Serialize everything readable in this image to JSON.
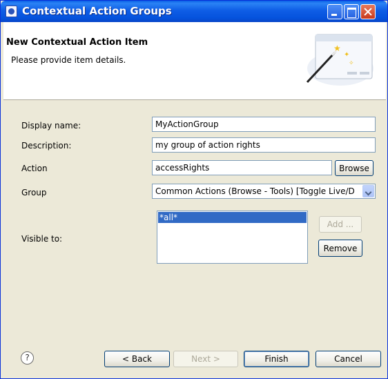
{
  "window": {
    "title": "Contextual Action Groups"
  },
  "header": {
    "title": "New Contextual Action Item",
    "subtitle": "Please provide item details."
  },
  "form": {
    "display_name": {
      "label": "Display name:",
      "value": "MyActionGroup"
    },
    "description": {
      "label": "Description:",
      "value": "my group of action rights"
    },
    "action": {
      "label": "Action",
      "value": "accessRights",
      "browse_label": "Browse"
    },
    "group": {
      "label": "Group",
      "value": "Common Actions (Browse - Tools) [Toggle Live/D"
    },
    "visible_to": {
      "label": "Visible to:",
      "items": [
        "*all*"
      ],
      "add_label": "Add ...",
      "remove_label": "Remove"
    }
  },
  "footer": {
    "help_glyph": "?",
    "back_label": "< Back",
    "next_label": "Next >",
    "finish_label": "Finish",
    "cancel_label": "Cancel"
  },
  "icons": {
    "app": "app-icon",
    "wizard": "magic-wand-icon",
    "help": "help-icon"
  }
}
